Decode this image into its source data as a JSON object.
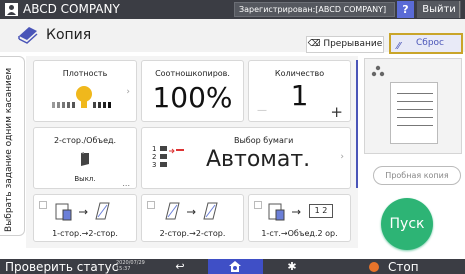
{
  "topbar": {
    "company": "ABCD COMPANY",
    "login_status": "Зарегистрирован:[ABCD COMPANY]",
    "help_label": "?",
    "logout_label": "Выйти",
    "edge_label": "(",
    "user_icon": "user-icon"
  },
  "titlebar": {
    "title": "Копия",
    "app_icon": "copier-icon",
    "interrupt_label": "Прерывание",
    "reset_label": "Сброс"
  },
  "side_tab": {
    "label": "Выбрать задание одним касанием",
    "icon": "touch-icon"
  },
  "tiles": {
    "density": {
      "label": "Плотность",
      "level_fraction": 0.5
    },
    "ratio": {
      "label": "Соотношкопиров.",
      "value": "100%"
    },
    "quantity": {
      "label": "Количество",
      "value": "1",
      "minus": "—",
      "plus": "+"
    },
    "duplex": {
      "label": "2-стор./Объед.",
      "status": "Выкл.",
      "more": "..."
    },
    "paper": {
      "label": "Выбор бумаги",
      "value": "Автомат.",
      "trays": [
        "1",
        "2",
        "3"
      ]
    },
    "shortcut1": {
      "label": "1-стор.→2-стор."
    },
    "shortcut2": {
      "label": "2-стор.→2-стор."
    },
    "shortcut3": {
      "label": "1-ст.→Объед.2 ор.",
      "combine_label": "1 2"
    }
  },
  "right_panel": {
    "sample_label": "Пробная копия",
    "start_label": "Пуск"
  },
  "bottombar": {
    "check_status": "Проверить статус",
    "date": "2020/07/29",
    "time": "15:37",
    "stop_label": "Стоп"
  },
  "colors": {
    "accent": "#4a55b8",
    "start": "#2db475",
    "density_marker": "#f0b81c",
    "stop": "#e8742a"
  }
}
